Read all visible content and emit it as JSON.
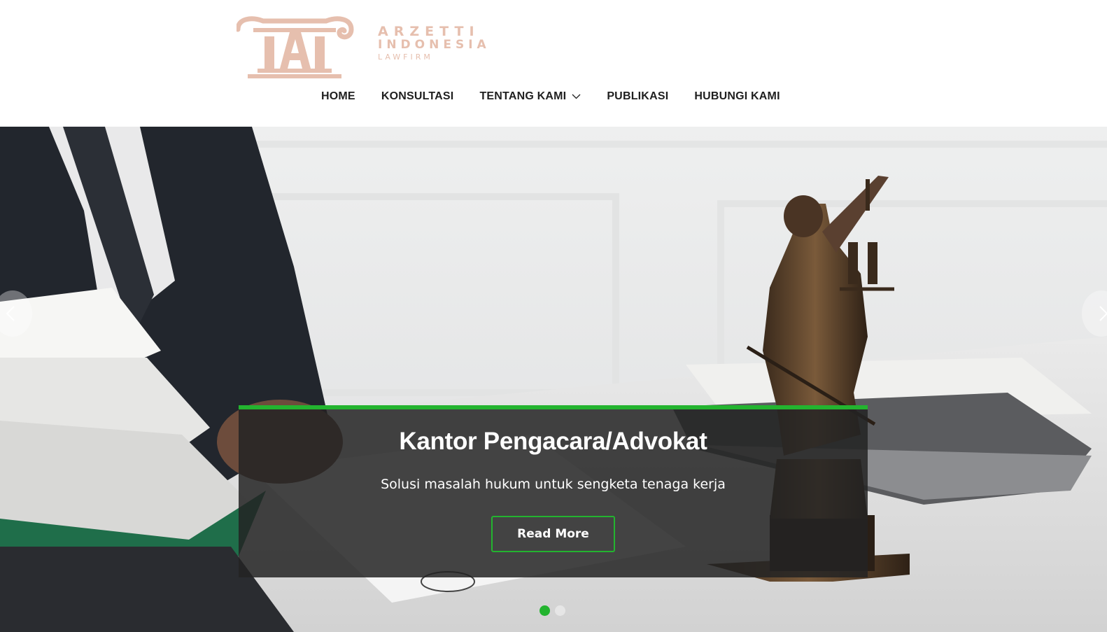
{
  "brand": {
    "line1": "ARZETTI",
    "line2": "INDONESIA",
    "line3": "LAWFIRM",
    "logo_color": "#e6bfae"
  },
  "nav": {
    "items": [
      {
        "label": "HOME"
      },
      {
        "label": "KONSULTASI"
      },
      {
        "label": "TENTANG KAMI",
        "has_dropdown": true
      },
      {
        "label": "PUBLIKASI"
      },
      {
        "label": "HUBUNGI KAMI"
      }
    ]
  },
  "slider": {
    "title": "Kantor Pengacara/Advokat",
    "subtitle": "Solusi masalah hukum untuk sengketa tenaga kerja",
    "button_label": "Read More",
    "total_slides": 2,
    "active_slide": 1,
    "accent_color": "#23b42f"
  }
}
